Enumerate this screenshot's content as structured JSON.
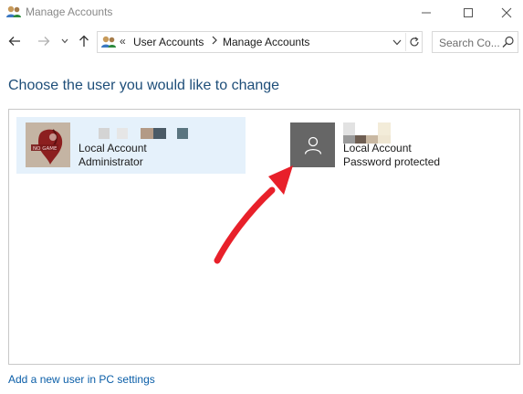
{
  "window": {
    "title": "Manage Accounts",
    "controls": {
      "minimize_icon": "minimize-icon",
      "maximize_icon": "maximize-icon",
      "close_icon": "close-icon"
    }
  },
  "nav": {
    "address_separator": "«",
    "breadcrumbs": [
      "User Accounts",
      "Manage Accounts"
    ],
    "search_placeholder": "Search Co..."
  },
  "main": {
    "heading": "Choose the user you would like to change",
    "users": [
      {
        "name_obscured": true,
        "type": "Local Account",
        "detail": "Administrator",
        "selected": true,
        "avatar": "profile-photo"
      },
      {
        "name_obscured": true,
        "type": "Local Account",
        "detail": "Password protected",
        "selected": false,
        "avatar": "default-user-icon"
      }
    ],
    "add_user_link": "Add a new user in PC settings"
  },
  "colors": {
    "heading": "#1e4e79",
    "link": "#0a5ea8",
    "selected_tile": "#e5f1fb",
    "arrow": "#e8202a"
  }
}
